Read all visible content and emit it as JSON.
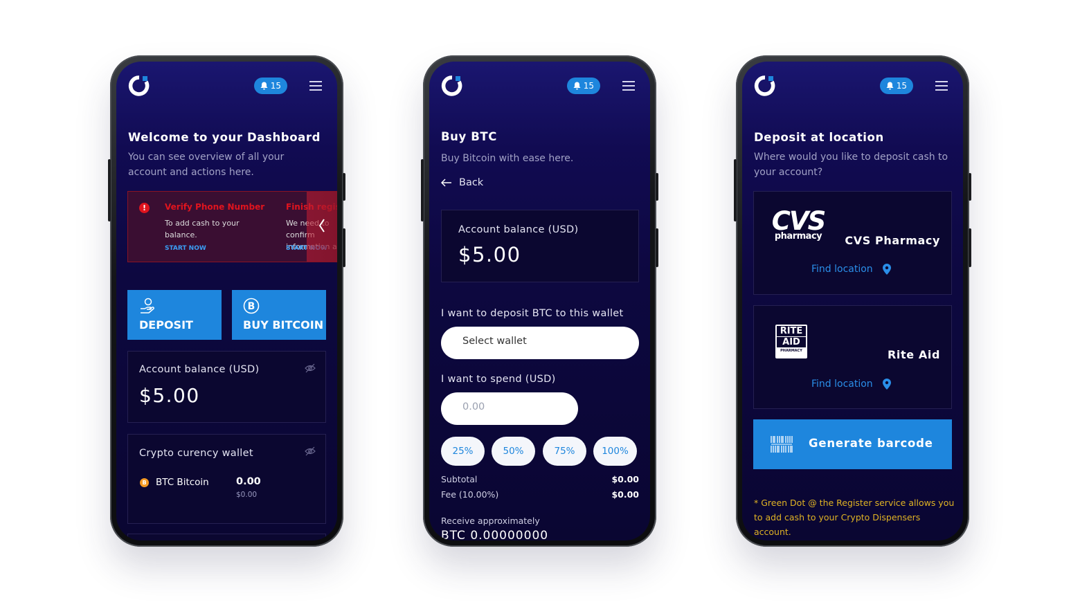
{
  "common": {
    "notification_count": "15"
  },
  "dashboard": {
    "title": "Welcome to your Dashboard",
    "subtitle": "You can see overview of all your account and actions here.",
    "alert1": {
      "title": "Verify Phone Number",
      "text": "To add cash to your balance.",
      "action": "START NOW"
    },
    "alert2": {
      "title": "Finish registr",
      "text": "We need to confirm information a",
      "action": "START NOW"
    },
    "deposit_label": "DEPOSIT",
    "buy_label": "BUY BITCOIN",
    "balance_label": "Account balance (USD)",
    "balance_value": "$5.00",
    "wallet_title": "Crypto curency wallet",
    "wallet_item": {
      "name": "BTC Bitcoin",
      "amount": "0.00",
      "usd": "$0.00"
    }
  },
  "buy": {
    "title": "Buy BTC",
    "subtitle": "Buy Bitcoin with ease here.",
    "back_label": "Back",
    "balance_label": "Account balance (USD)",
    "balance_value": "$5.00",
    "wallet_label": "I want to deposit BTC to this wallet",
    "wallet_select": "Select wallet",
    "spend_label": "I want to spend (USD)",
    "spend_placeholder": "0.00",
    "percent_options": [
      "25%",
      "50%",
      "75%",
      "100%"
    ],
    "subtotal_label": "Subtotal",
    "subtotal_value": "$0.00",
    "fee_label": "Fee (10.00%)",
    "fee_value": "$0.00",
    "receive_label": "Receive approximately",
    "receive_value": "BTC 0.00000000"
  },
  "deposit": {
    "title": "Deposit at location",
    "subtitle": "Where would you like to deposit cash to your account?",
    "cvs_logo_top": "CVS",
    "cvs_logo_bottom": "pharmacy",
    "cvs_name": "CVS Pharmacy",
    "find_label": "Find location",
    "rite_logo_top": "RITE",
    "rite_logo_bottom": "AID",
    "rite_logo_sub": "PHARMACY",
    "rite_name": "Rite Aid",
    "generate_label": "Generate barcode",
    "footnote": "* Green Dot @ the Register service allows you to add cash to your Crypto Dispensers account."
  },
  "colors": {
    "accent": "#1e86dd",
    "background": "#0d0840",
    "alert_red": "#e0141e"
  }
}
